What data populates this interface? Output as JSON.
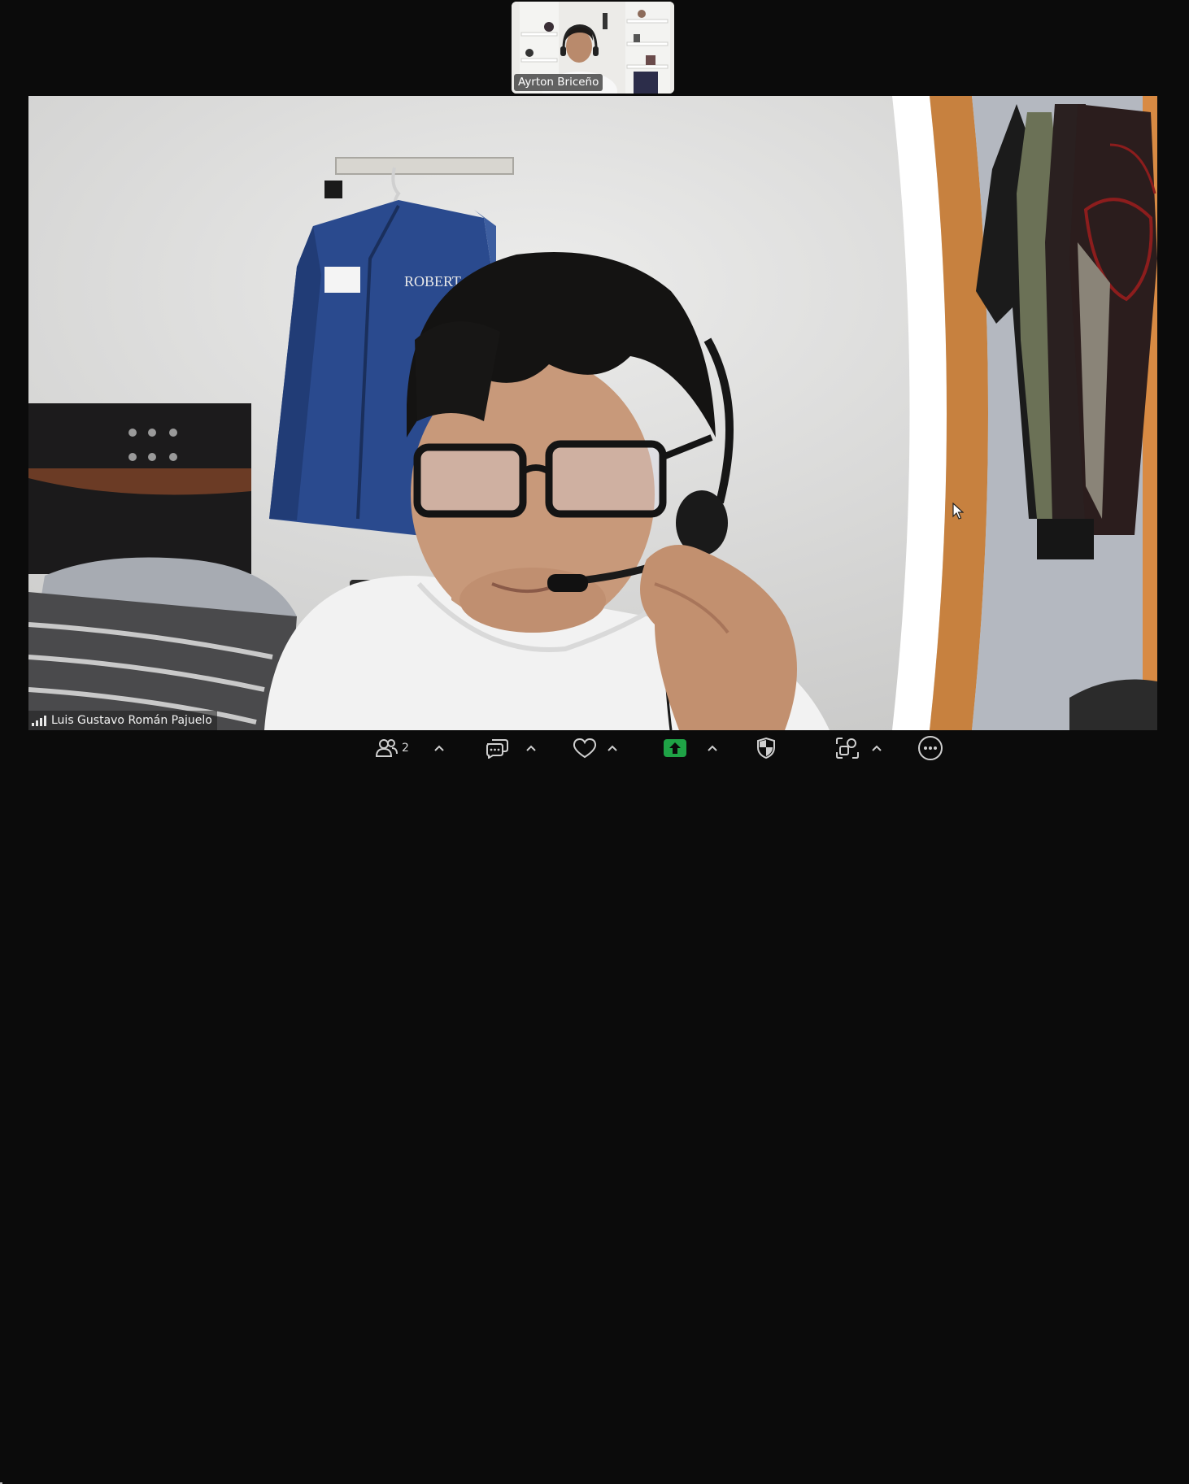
{
  "self_view": {
    "name": "Ayrton Briceño"
  },
  "speaker": {
    "name": "Luis Gustavo Román Pajuelo",
    "garment_bag_text": "ROBERT"
  },
  "toolbar": {
    "participants_icon": "participants-icon",
    "participants_count": "2",
    "chat_icon": "chat-icon",
    "reactions_icon": "heart-icon",
    "share_icon": "share-screen-icon",
    "share_color": "#1fa346",
    "security_icon": "shield-icon",
    "apps_icon": "apps-icon",
    "more_icon": "more-icon"
  },
  "colors": {
    "background": "#0b0b0b",
    "toolbar_icon": "#cfcfcf"
  }
}
